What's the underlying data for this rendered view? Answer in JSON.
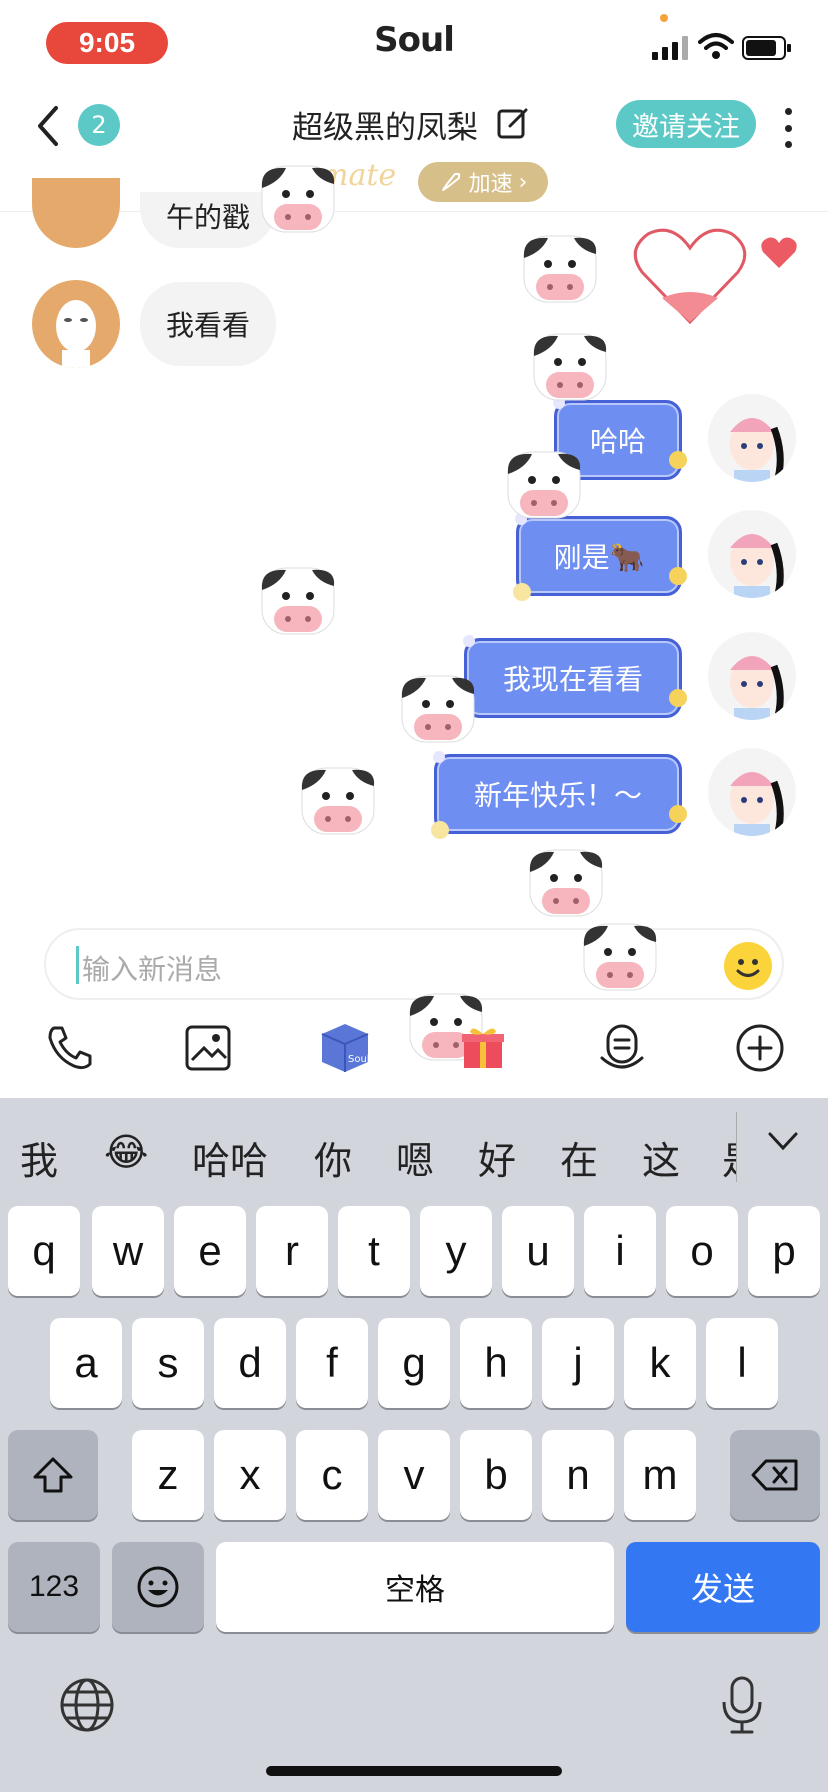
{
  "status_bar": {
    "time": "9:05",
    "app_name": "Soul"
  },
  "header": {
    "unread_count": "2",
    "title": "超级黑的凤梨",
    "invite_label": "邀请关注",
    "soulmate_text": "mate",
    "boost_label": "加速"
  },
  "messages": [
    {
      "side": "left",
      "text": "午的戳"
    },
    {
      "side": "left",
      "text": "我看看"
    },
    {
      "side": "right",
      "text": "哈哈"
    },
    {
      "side": "right",
      "text": "刚是🐂"
    },
    {
      "side": "right",
      "text": "我现在看看"
    },
    {
      "side": "right",
      "text": "新年快乐！～"
    }
  ],
  "input": {
    "placeholder": "输入新消息"
  },
  "toolbar": {
    "icons": [
      "phone-icon",
      "image-icon",
      "soul-box-icon",
      "gift-icon",
      "voice-icon",
      "plus-icon"
    ],
    "soul_box_label": "Soul"
  },
  "keyboard": {
    "suggestions": [
      "我",
      "😂",
      "哈哈",
      "你",
      "嗯",
      "好",
      "在",
      "这",
      "是"
    ],
    "row1": [
      "q",
      "w",
      "e",
      "r",
      "t",
      "y",
      "u",
      "i",
      "o",
      "p"
    ],
    "row2": [
      "a",
      "s",
      "d",
      "f",
      "g",
      "h",
      "j",
      "k",
      "l"
    ],
    "row3": [
      "z",
      "x",
      "c",
      "v",
      "b",
      "n",
      "m"
    ],
    "num_label": "123",
    "space_label": "空格",
    "send_label": "发送"
  },
  "colors": {
    "accent_teal": "#5cc9c7",
    "bubble_blue": "#6e8ef2",
    "send_blue": "#3378f2",
    "status_red": "#e8473c"
  }
}
